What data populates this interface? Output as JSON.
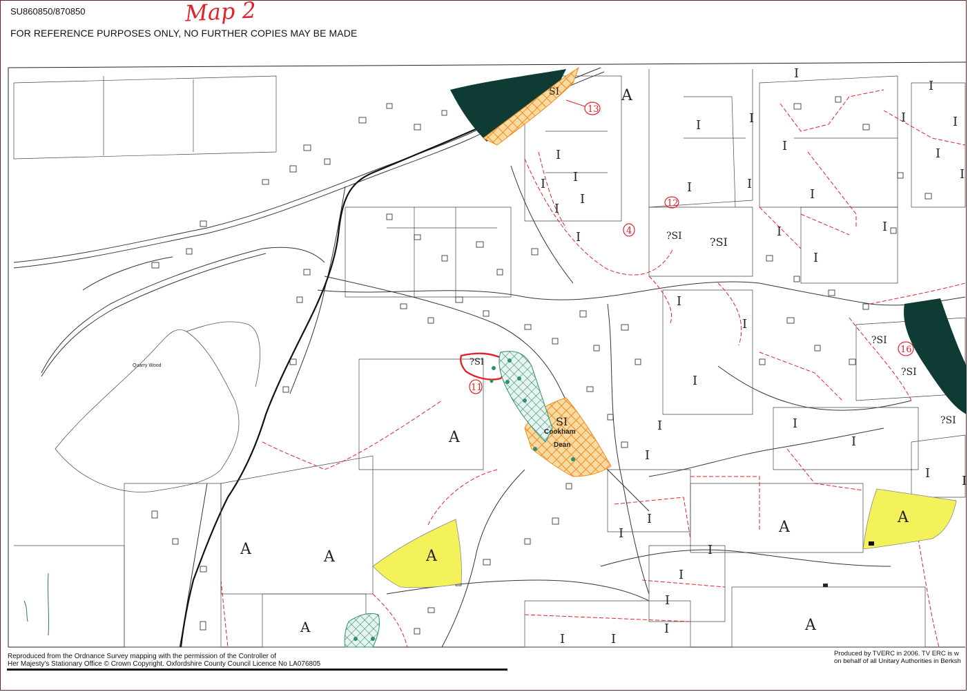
{
  "header": {
    "grid_ref": "SU860850/870850",
    "notice": "FOR REFERENCE PURPOSES ONLY, NO FURTHER COPIES MAY BE MADE",
    "title": "Map 2"
  },
  "map": {
    "place_labels": {
      "quarry_wood": "Quarry Wood",
      "cookham_dean": "Cookham\nDean"
    },
    "annotations": {
      "n13": "13",
      "n12": "12",
      "n4": "4",
      "n11": "11",
      "n16": "16"
    },
    "class_letters": {
      "A": "A",
      "I": "I",
      "SI": "SI",
      "qSI": "?SI"
    },
    "colors": {
      "yellow": "#f4f25a",
      "orange": "#f3b04a",
      "dark_green": "#0f3b35",
      "teal": "#2f8d76",
      "boundary": "#e0222a"
    }
  },
  "footer": {
    "credit_left_line1": "Reproduced from the Ordnance Survey mapping with the permission of the Controller of",
    "credit_left_line2": "Her Majesty's Stationary Office © Crown Copyright. Oxfordshire County Council Licence No LA076805",
    "credit_right_line1": "Produced by TVERC in 2006. TV ERC is w",
    "credit_right_line2": "on behalf of all Unitary Authorities in Berksh"
  }
}
